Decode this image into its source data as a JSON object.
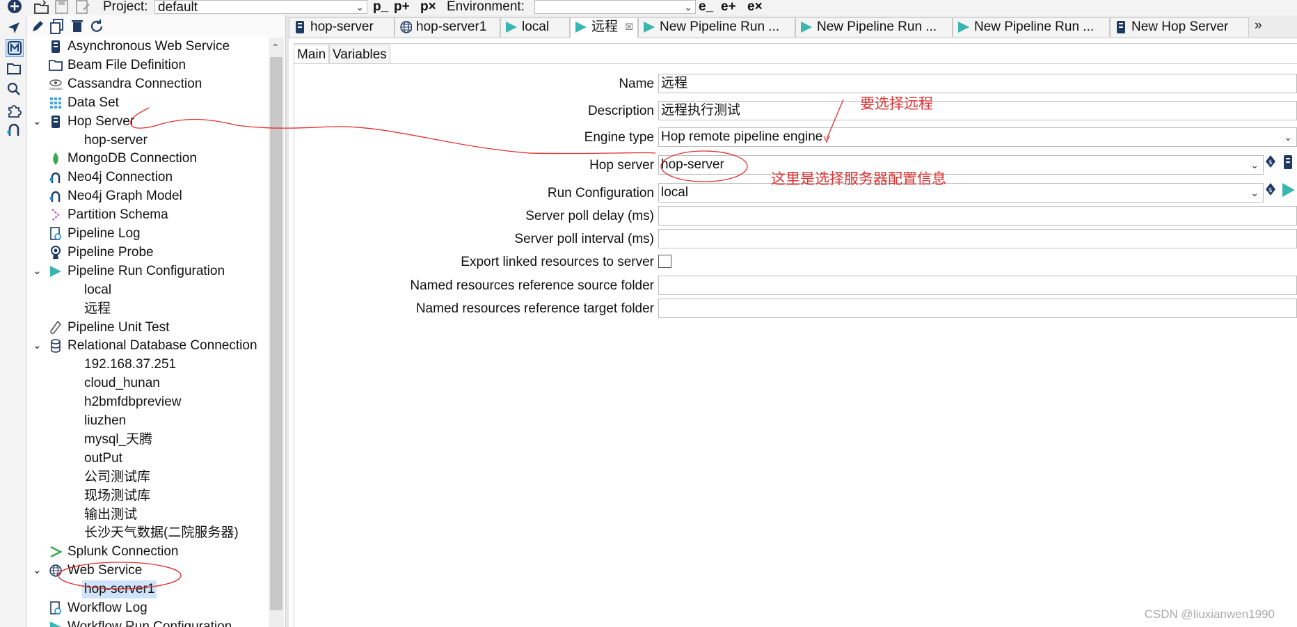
{
  "toolbar": {
    "project_label": "Project:",
    "project_value": "default",
    "environment_label": "Environment:",
    "environment_value": "",
    "project_buttons": [
      "p_",
      "p+",
      "p×"
    ],
    "environment_buttons": [
      "e_",
      "e+",
      "e×"
    ]
  },
  "rail": {
    "icons": [
      "add-icon",
      "cursor-icon",
      "metadata-icon",
      "folder-icon",
      "search-icon",
      "plugin-icon",
      "neo4j-icon"
    ]
  },
  "metadata_toolbar": {
    "icons": [
      "edit-icon",
      "duplicate-icon",
      "delete-icon",
      "refresh-icon"
    ]
  },
  "tree": [
    {
      "label": "Asynchronous Web Service",
      "icon": "server-icon",
      "expandable": false
    },
    {
      "label": "Beam File Definition",
      "icon": "folder-icon",
      "expandable": false
    },
    {
      "label": "Cassandra Connection",
      "icon": "cassandra-icon",
      "expandable": false
    },
    {
      "label": "Data Set",
      "icon": "dataset-icon",
      "expandable": false
    },
    {
      "label": "Hop Server",
      "icon": "server-icon",
      "expandable": true,
      "children": [
        "hop-server"
      ]
    },
    {
      "label": "MongoDB Connection",
      "icon": "mongodb-leaf-icon",
      "expandable": false
    },
    {
      "label": "Neo4j Connection",
      "icon": "neo4j-icon",
      "expandable": false
    },
    {
      "label": "Neo4j Graph Model",
      "icon": "neo4j-icon",
      "expandable": false
    },
    {
      "label": "Partition Schema",
      "icon": "partition-icon",
      "expandable": false
    },
    {
      "label": "Pipeline Log",
      "icon": "log-icon",
      "expandable": false
    },
    {
      "label": "Pipeline Probe",
      "icon": "probe-icon",
      "expandable": false
    },
    {
      "label": "Pipeline Run Configuration",
      "icon": "run-icon",
      "expandable": true,
      "children": [
        "local",
        "远程"
      ]
    },
    {
      "label": "Pipeline Unit Test",
      "icon": "test-tube-icon",
      "expandable": false
    },
    {
      "label": "Relational Database Connection",
      "icon": "database-icon",
      "expandable": true,
      "children": [
        "192.168.37.251",
        "cloud_hunan",
        "h2bmfdbpreview",
        "liuzhen",
        "mysql_天腾",
        "outPut",
        "公司测试库",
        "现场测试库",
        "输出测试",
        "长沙天气数据(二院服务器)"
      ]
    },
    {
      "label": "Splunk Connection",
      "icon": "splunk-icon",
      "expandable": false
    },
    {
      "label": "Web Service",
      "icon": "globe-icon",
      "expandable": true,
      "children": [
        "hop-server1"
      ]
    },
    {
      "label": "Workflow Log",
      "icon": "log-icon",
      "expandable": false
    },
    {
      "label": "Workflow Run Configuration",
      "icon": "run-icon",
      "expandable": false
    }
  ],
  "tabs": [
    {
      "label": "hop-server",
      "icon": "server-icon"
    },
    {
      "label": "hop-server1",
      "icon": "globe-icon"
    },
    {
      "label": "local",
      "icon": "run-icon"
    },
    {
      "label": "远程",
      "icon": "run-icon",
      "active": true
    },
    {
      "label": "New Pipeline Run ...",
      "icon": "run-icon"
    },
    {
      "label": "New Pipeline Run ...",
      "icon": "run-icon"
    },
    {
      "label": "New Pipeline Run ...",
      "icon": "run-icon"
    },
    {
      "label": "New Hop Server",
      "icon": "server-icon"
    }
  ],
  "tab_overflow": "»",
  "subtabs": {
    "main": "Main",
    "variables": "Variables"
  },
  "form": {
    "name_label": "Name",
    "name_value": "远程",
    "description_label": "Description",
    "description_value": "远程执行测试",
    "engine_label": "Engine type",
    "engine_value": "Hop remote pipeline engine",
    "server_label": "Hop server",
    "server_value": "hop-server",
    "runconfig_label": "Run Configuration",
    "runconfig_value": "local",
    "poll_delay_label": "Server poll delay (ms)",
    "poll_delay_value": "",
    "poll_interval_label": "Server poll interval (ms)",
    "poll_interval_value": "",
    "export_label": "Export linked resources to server",
    "export_checked": false,
    "src_folder_label": "Named resources reference source folder",
    "src_folder_value": "",
    "tgt_folder_label": "Named resources reference target folder",
    "tgt_folder_value": ""
  },
  "annotations": {
    "engine_note": "要选择远程",
    "server_note": "这里是选择服务器配置信息"
  },
  "watermark": "CSDN @liuxianwen1990",
  "colors": {
    "annotation": "#e03030",
    "run_icon": "#3bb5b0",
    "selection": "#cfe3fb"
  }
}
